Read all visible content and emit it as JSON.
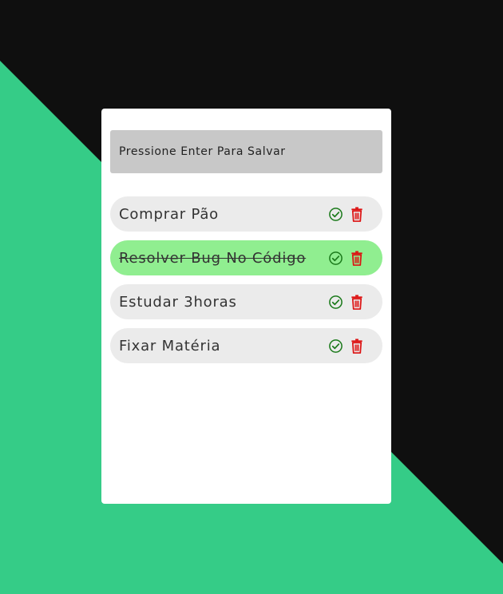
{
  "colors": {
    "background_green": "#35cc87",
    "background_black": "#0f0f0f",
    "card": "#ffffff",
    "input_bg": "#c8c8c8",
    "item_bg": "#ebebeb",
    "item_done_bg": "#90ee90",
    "check_icon": "#1b7a1b",
    "trash_icon": "#dd1111"
  },
  "input": {
    "placeholder": "Pressione Enter Para Salvar",
    "value": ""
  },
  "tasks": [
    {
      "label": "Comprar Pão",
      "done": false,
      "complete_icon": "check-circle-icon",
      "delete_icon": "trash-icon"
    },
    {
      "label": "Resolver Bug No Código",
      "done": true,
      "complete_icon": "check-circle-icon",
      "delete_icon": "trash-icon"
    },
    {
      "label": "Estudar 3horas",
      "done": false,
      "complete_icon": "check-circle-icon",
      "delete_icon": "trash-icon"
    },
    {
      "label": "Fixar Matéria",
      "done": false,
      "complete_icon": "check-circle-icon",
      "delete_icon": "trash-icon"
    }
  ]
}
